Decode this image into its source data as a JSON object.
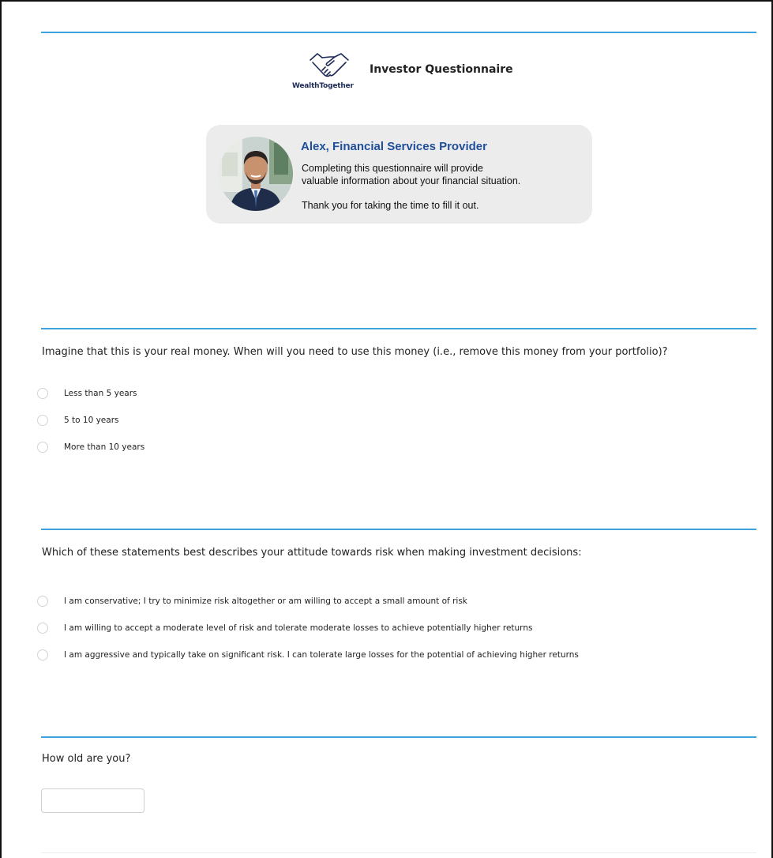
{
  "header": {
    "brand_name": "WealthTogether",
    "title": "Investor Questionnaire"
  },
  "intro_card": {
    "name": "Alex, Financial Services Provider",
    "line1": "Completing this questionnaire will provide",
    "line2": "valuable information about your financial situation.",
    "line3": "Thank you for taking the time to fill it out."
  },
  "questions": [
    {
      "text": "Imagine that this is your real money. When will you need to use this money (i.e., remove this money from your portfolio)?",
      "options": [
        {
          "label": "Less than 5 years",
          "selected": false
        },
        {
          "label": "5 to 10 years",
          "selected": false
        },
        {
          "label": "More than 10 years",
          "selected": false
        }
      ]
    },
    {
      "text": "Which of these statements best describes your attitude towards risk when making investment decisions:",
      "options": [
        {
          "label": "I am conservative; I try to minimize risk altogether or am willing to accept a small amount of risk",
          "selected": false
        },
        {
          "label": "I am willing to accept a moderate level of risk and tolerate moderate losses to achieve potentially higher returns",
          "selected": false
        },
        {
          "label": "I am aggressive and typically take on significant risk. I can tolerate large losses for the potential of achieving higher returns",
          "selected": false
        }
      ]
    },
    {
      "text": "How old are you?",
      "input_value": "",
      "placeholder": ""
    }
  ],
  "colors": {
    "accent_rule": "#3ea3dc",
    "card_name": "#1f4e9a",
    "brand": "#1d2a55"
  },
  "icons": {
    "logo": "handshake-icon",
    "avatar": "person-photo"
  }
}
